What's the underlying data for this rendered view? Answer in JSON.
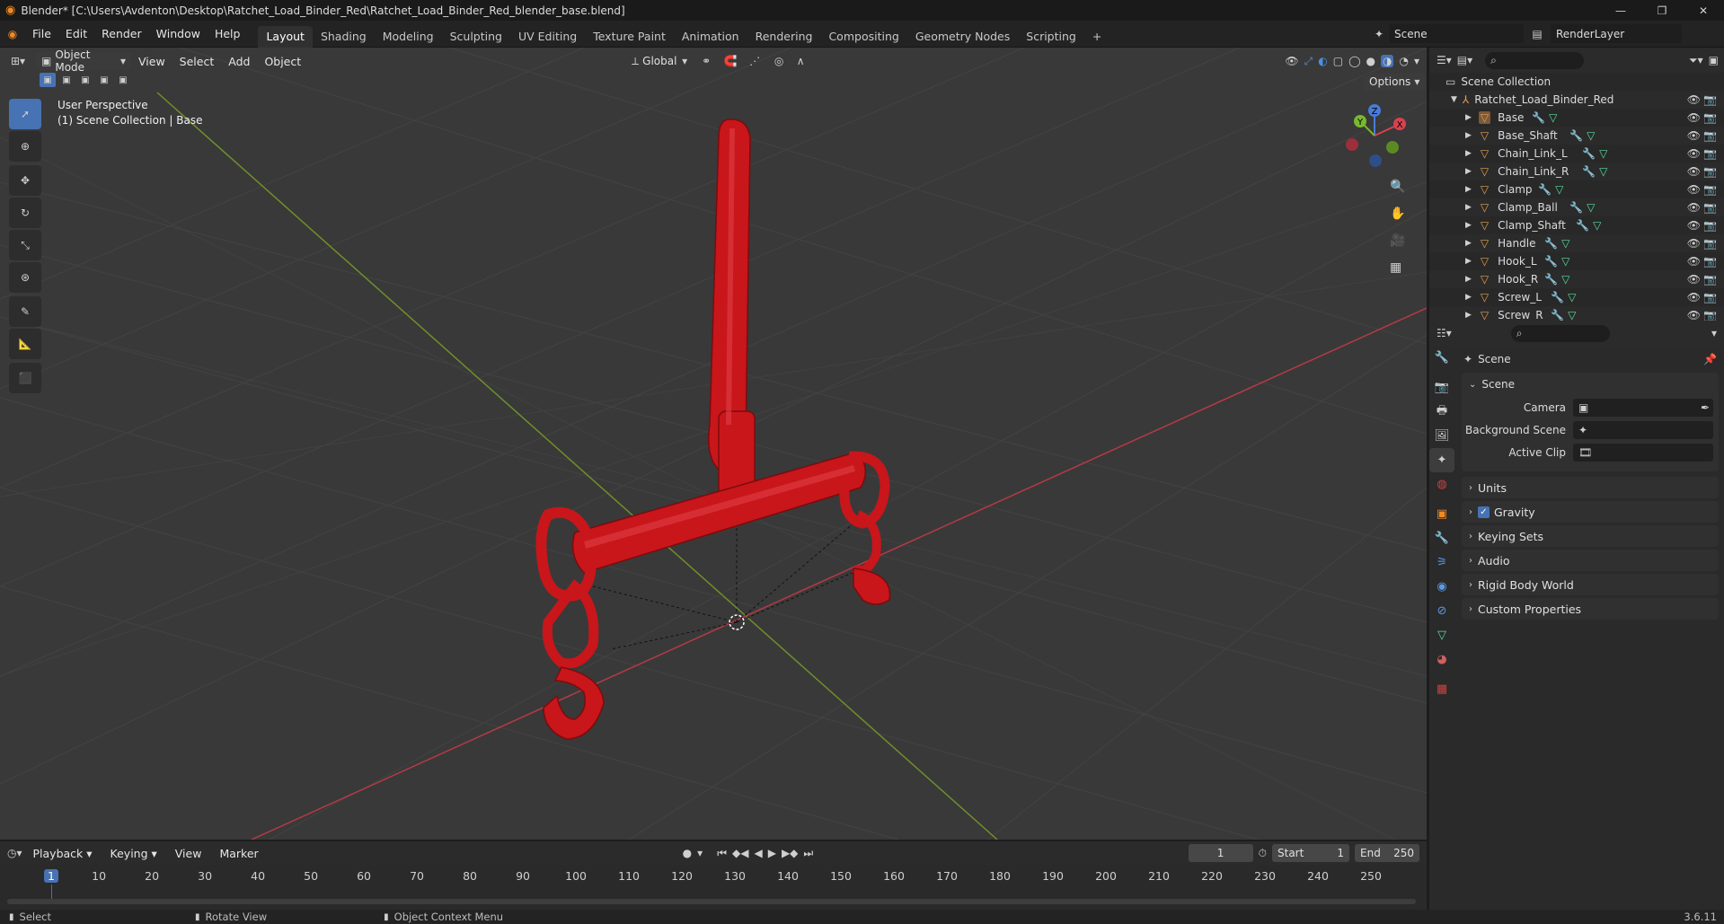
{
  "titlebar": {
    "title": "Blender* [C:\\Users\\Avdenton\\Desktop\\Ratchet_Load_Binder_Red\\Ratchet_Load_Binder_Red_blender_base.blend]"
  },
  "menus": [
    "File",
    "Edit",
    "Render",
    "Window",
    "Help"
  ],
  "workspaces": [
    "Layout",
    "Shading",
    "Modeling",
    "Sculpting",
    "UV Editing",
    "Texture Paint",
    "Animation",
    "Rendering",
    "Compositing",
    "Geometry Nodes",
    "Scripting"
  ],
  "scene_name": "Scene",
  "view_layer": "RenderLayer",
  "viewport_header": {
    "mode": "Object Mode",
    "menus": [
      "View",
      "Select",
      "Add",
      "Object"
    ],
    "transform": "Global",
    "options": "Options"
  },
  "viewport_info": {
    "perspective": "User Perspective",
    "collection": "(1) Scene Collection | Base"
  },
  "gizmo": {
    "x": "X",
    "y": "Y",
    "z": "Z"
  },
  "outliner": {
    "root": "Scene Collection",
    "collection": "Ratchet_Load_Binder_Red",
    "objects": [
      "Base",
      "Base_Shaft",
      "Chain_Link_L",
      "Chain_Link_R",
      "Clamp",
      "Clamp_Ball",
      "Clamp_Shaft",
      "Handle",
      "Hook_L",
      "Hook_R",
      "Screw_L",
      "Screw_R"
    ]
  },
  "properties": {
    "context": "Scene",
    "scene_panel": "Scene",
    "camera_label": "Camera",
    "background_label": "Background Scene",
    "clip_label": "Active Clip",
    "panels": [
      "Units",
      "Gravity",
      "Keying Sets",
      "Audio",
      "Rigid Body World",
      "Custom Properties"
    ]
  },
  "timeline": {
    "menus": [
      "Playback",
      "Keying",
      "View",
      "Marker"
    ],
    "current_frame": "1",
    "start_label": "Start",
    "start": "1",
    "end_label": "End",
    "end": "250",
    "ticks": [
      "1",
      "10",
      "20",
      "30",
      "40",
      "50",
      "60",
      "70",
      "80",
      "90",
      "100",
      "110",
      "120",
      "130",
      "140",
      "150",
      "160",
      "170",
      "180",
      "190",
      "200",
      "210",
      "220",
      "230",
      "240",
      "250"
    ]
  },
  "statusbar": {
    "select": "Select",
    "rotate": "Rotate View",
    "context": "Object Context Menu",
    "version": "3.6.11"
  },
  "colors": {
    "accent": "#4772b3",
    "object_red": "#c8161b",
    "axis_x": "#d8414f",
    "axis_y": "#7ab82d"
  }
}
